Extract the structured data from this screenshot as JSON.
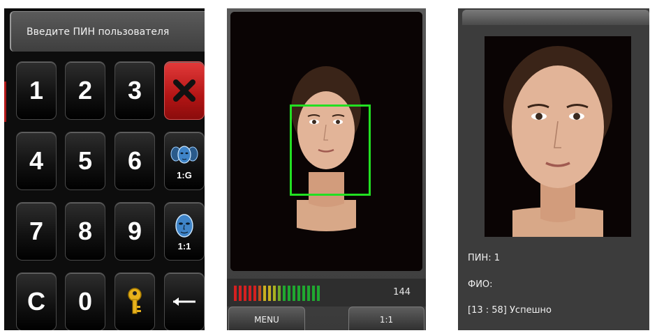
{
  "keypad": {
    "pin_prompt": "Введите ПИН пользователя",
    "keys": {
      "k1": "1",
      "k2": "2",
      "k3": "3",
      "k4": "4",
      "k5": "5",
      "k6": "6",
      "k7": "7",
      "k8": "8",
      "k9": "9",
      "kC": "C",
      "k0": "0"
    },
    "one_to_group_label": "1:G",
    "one_to_one_label": "1:1"
  },
  "capture": {
    "quality_score": "144",
    "quality_level": 0.6,
    "menu_label": "MENU",
    "mode_label": "1:1"
  },
  "result": {
    "pin_line": "ПИН: 1",
    "name_line": "ФИО:",
    "status_line": "[13 : 58] Успешно"
  },
  "colors": {
    "cancel_red": "#c41e1e",
    "detection_green": "#22e022",
    "meter_red": "#d42020",
    "meter_yellow": "#c8b020",
    "meter_green": "#20a830"
  }
}
